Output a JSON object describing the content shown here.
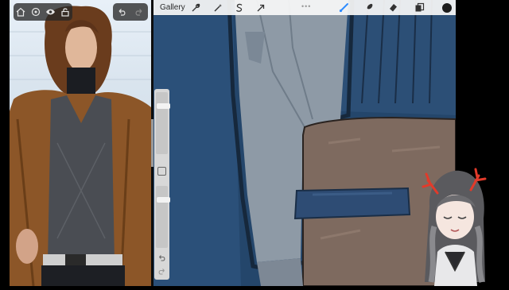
{
  "topbar": {
    "gallery_label": "Gallery",
    "more_dots": "•••",
    "color_swatch": "#1c1c1c",
    "tools": [
      {
        "name": "wrench-icon"
      },
      {
        "name": "magic-wand-icon"
      },
      {
        "name": "selection-icon"
      },
      {
        "name": "transform-arrow-icon"
      },
      {
        "name": "brush-icon",
        "active": true,
        "color": "#2f8cff"
      },
      {
        "name": "smudge-icon"
      },
      {
        "name": "eraser-icon"
      },
      {
        "name": "layers-icon"
      }
    ]
  },
  "reference_window": {
    "toolbar_icons": [
      "home-icon",
      "settings-icon",
      "eye-icon",
      "lock-icon"
    ],
    "undo_icons": [
      "undo-icon",
      "redo-icon"
    ]
  },
  "side_bar": {
    "brush_size_level": 0.2,
    "opacity_level": 0.2
  },
  "colors": {
    "canvas_blue": "#24466b",
    "shirt_grey": "#8e9aa6",
    "jacket_brown": "#7e6a5f",
    "brush_active": "#2f8cff"
  }
}
